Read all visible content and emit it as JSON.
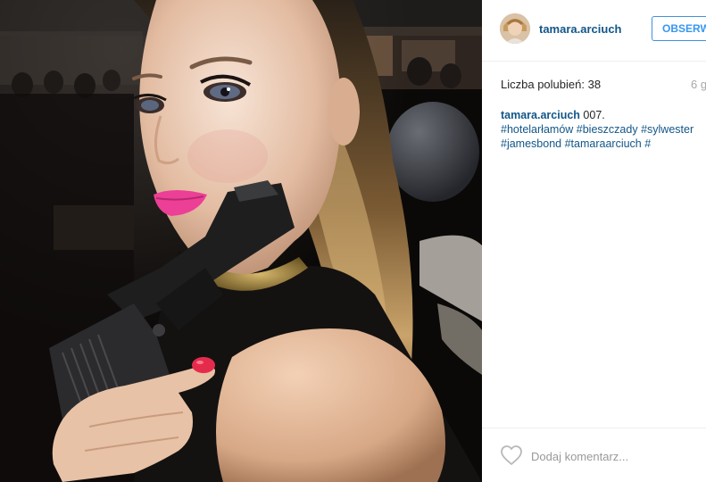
{
  "post": {
    "user": {
      "username": "tamara.arciuch"
    },
    "follow_button_label": "OBSERWUJ",
    "likes": {
      "label": "Liczba polubień:",
      "count": "38"
    },
    "timestamp": "6 g",
    "caption": {
      "username": "tamara.arciuch",
      "text": "007.",
      "hashtags_line1": [
        "#hotelarłamów",
        "#bieszczady",
        "#sylwester"
      ],
      "hashtags_line2": [
        "#jamesbond",
        "#tamaraarciuch",
        "#"
      ]
    },
    "comment": {
      "placeholder": "Dodaj komentarz..."
    },
    "icons": {
      "like": "heart-icon"
    },
    "colors": {
      "username": "#125688",
      "follow_button": "#3897f0",
      "text": "#262626",
      "muted": "#a5a7aa",
      "divider": "#efefef"
    }
  }
}
